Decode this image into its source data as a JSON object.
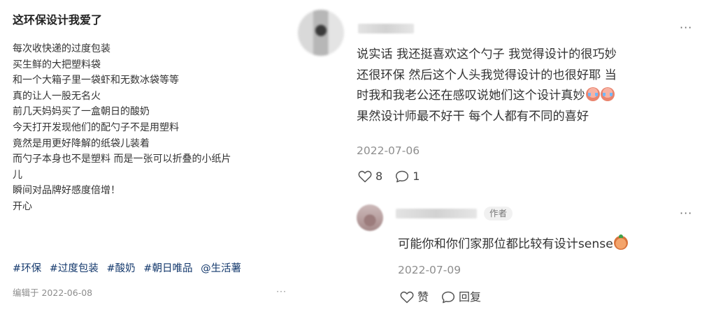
{
  "post": {
    "title": "这环保设计我爱了",
    "body_lines": [
      "每次收快递的过度包装",
      "买生鲜的大把塑料袋",
      "和一个大箱子里一袋虾和无数冰袋等等",
      "真的让人一股无名火",
      "前几天妈妈买了一盒朝日的酸奶",
      "今天打开发现他们的配勺子不是用塑料",
      "竟然是用更好降解的纸袋儿装着",
      "而勺子本身也不是塑料 而是一张可以折叠的小纸片",
      "儿",
      "瞬间对品牌好感度倍增！",
      "开心"
    ],
    "tags": [
      "#环保",
      "#过度包装",
      "#酸奶",
      "#朝日唯品",
      "@生活薯"
    ],
    "edited": "编辑于 2022-06-08",
    "more": "···"
  },
  "comment": {
    "more": "···",
    "text_lines": [
      "说实话 我还挺喜欢这个勺子 我觉得设计的很巧妙",
      "还很环保 然后这个人头我觉得设计的也很好耶 当",
      "时我和我老公还在感叹说她们这个设计真妙",
      "果然设计师最不好干 每个人都有不同的喜好"
    ],
    "date": "2022-07-06",
    "likes": "8",
    "replies": "1",
    "icons": [
      "heart-icon",
      "comment-bubble-icon",
      "crying-face-emoji"
    ]
  },
  "reply": {
    "badge": "作者",
    "more": "···",
    "text": "可能你和你们家那位都比较有设计sense",
    "date": "2022-07-09",
    "like_label": "赞",
    "reply_label": "回复",
    "icons": [
      "heart-icon",
      "comment-bubble-icon",
      "peach-face-emoji"
    ]
  },
  "colors": {
    "tag": "#13386c",
    "text": "#333333",
    "muted": "#8e8e8e"
  }
}
